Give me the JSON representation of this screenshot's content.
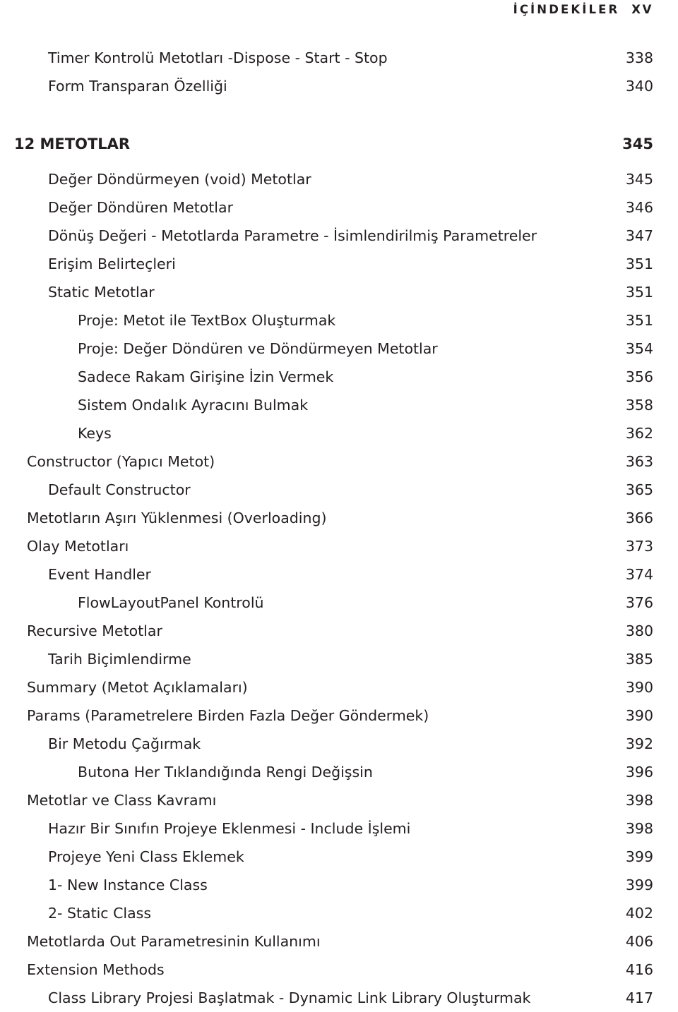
{
  "running_head": {
    "title": "İÇİNDEKİLER",
    "folio": "XV"
  },
  "toc": {
    "entries": [
      {
        "label": "Timer Kontrolü Metotları -Dispose - Start - Stop",
        "page": "338",
        "level": 2,
        "bold": false
      },
      {
        "label": "Form Transparan Özelliği",
        "page": "340",
        "level": 2,
        "bold": false
      },
      {
        "label": "12 METOTLAR",
        "page": "345",
        "level": 0,
        "bold": true
      },
      {
        "label": "Değer Döndürmeyen (void) Metotlar",
        "page": "345",
        "level": 2,
        "bold": false
      },
      {
        "label": "Değer Döndüren Metotlar",
        "page": "346",
        "level": 2,
        "bold": false
      },
      {
        "label": "Dönüş Değeri - Metotlarda Parametre - İsimlendirilmiş Parametreler",
        "page": "347",
        "level": 2,
        "bold": false
      },
      {
        "label": "Erişim Belirteçleri",
        "page": "351",
        "level": 2,
        "bold": false
      },
      {
        "label": "Static Metotlar",
        "page": "351",
        "level": 2,
        "bold": false
      },
      {
        "label": "Proje: Metot ile TextBox Oluşturmak",
        "page": "351",
        "level": 3,
        "bold": false
      },
      {
        "label": "Proje: Değer Döndüren ve Döndürmeyen Metotlar",
        "page": "354",
        "level": 3,
        "bold": false
      },
      {
        "label": "Sadece Rakam Girişine İzin Vermek",
        "page": "356",
        "level": 3,
        "bold": false
      },
      {
        "label": "Sistem Ondalık Ayracını Bulmak",
        "page": "358",
        "level": 3,
        "bold": false
      },
      {
        "label": "Keys",
        "page": "362",
        "level": 3,
        "bold": false
      },
      {
        "label": "Constructor (Yapıcı Metot)",
        "page": "363",
        "level": 1,
        "bold": false
      },
      {
        "label": "Default Constructor",
        "page": "365",
        "level": 2,
        "bold": false
      },
      {
        "label": "Metotların Aşırı Yüklenmesi (Overloading)",
        "page": "366",
        "level": 1,
        "bold": false
      },
      {
        "label": "Olay Metotları",
        "page": "373",
        "level": 1,
        "bold": false
      },
      {
        "label": "Event Handler",
        "page": "374",
        "level": 2,
        "bold": false
      },
      {
        "label": "FlowLayoutPanel Kontrolü",
        "page": "376",
        "level": 3,
        "bold": false
      },
      {
        "label": "Recursive Metotlar",
        "page": "380",
        "level": 1,
        "bold": false
      },
      {
        "label": "Tarih Biçimlendirme",
        "page": "385",
        "level": 2,
        "bold": false
      },
      {
        "label": "Summary (Metot Açıklamaları)",
        "page": "390",
        "level": 1,
        "bold": false
      },
      {
        "label": "Params (Parametrelere Birden Fazla Değer Göndermek)",
        "page": "390",
        "level": 1,
        "bold": false
      },
      {
        "label": "Bir Metodu Çağırmak",
        "page": "392",
        "level": 2,
        "bold": false
      },
      {
        "label": "Butona Her Tıklandığında Rengi Değişsin",
        "page": "396",
        "level": 3,
        "bold": false
      },
      {
        "label": "Metotlar ve Class Kavramı",
        "page": "398",
        "level": 1,
        "bold": false
      },
      {
        "label": "Hazır Bir Sınıfın Projeye Eklenmesi - Include İşlemi",
        "page": "398",
        "level": 2,
        "bold": false
      },
      {
        "label": "Projeye Yeni Class Eklemek",
        "page": "399",
        "level": 2,
        "bold": false
      },
      {
        "label": "1- New Instance Class",
        "page": "399",
        "level": 2,
        "bold": false
      },
      {
        "label": "2- Static Class",
        "page": "402",
        "level": 2,
        "bold": false
      },
      {
        "label": "Metotlarda Out Parametresinin Kullanımı",
        "page": "406",
        "level": 1,
        "bold": false
      },
      {
        "label": "Extension Methods",
        "page": "416",
        "level": 1,
        "bold": false
      },
      {
        "label": "Class Library Projesi Başlatmak - Dynamic Link Library Oluşturmak",
        "page": "417",
        "level": 2,
        "bold": false
      }
    ]
  },
  "colors": {
    "text": "#231f20",
    "background": "#ffffff"
  }
}
